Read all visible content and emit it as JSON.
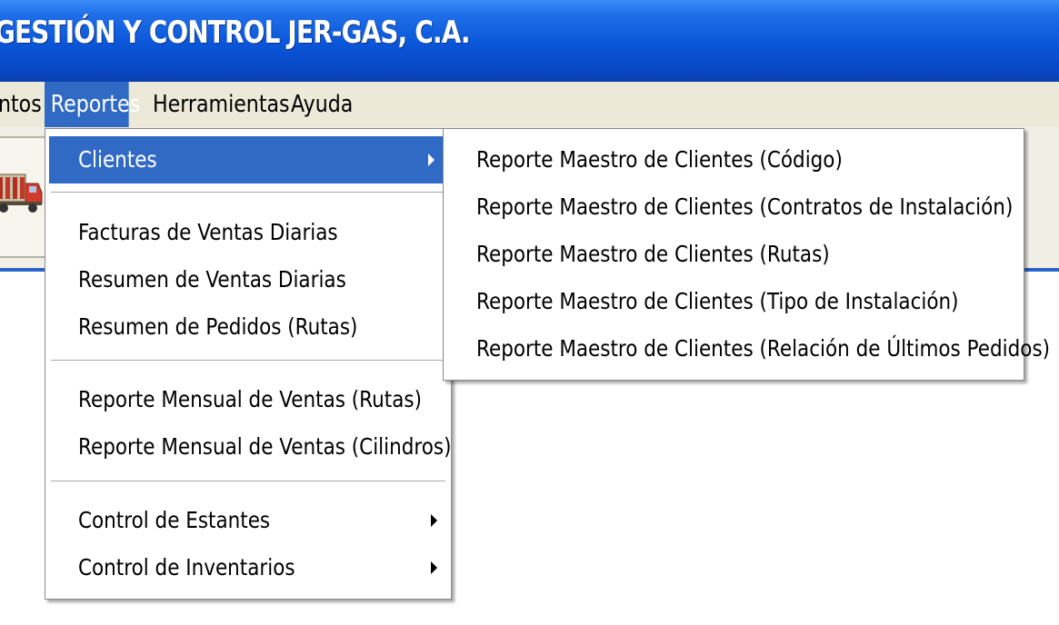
{
  "window": {
    "title": "GESTIÓN Y CONTROL JER-GAS, C.A."
  },
  "menubar": {
    "items": [
      {
        "label": "ntos"
      },
      {
        "label": "Reportes"
      },
      {
        "label": "Herramientas"
      },
      {
        "label": "Ayuda"
      }
    ]
  },
  "reportes_menu": {
    "clientes": "Clientes",
    "facturas_ventas_diarias": "Facturas de Ventas Diarias",
    "resumen_ventas_diarias": "Resumen de Ventas Diarias",
    "resumen_pedidos_rutas": "Resumen de Pedidos (Rutas)",
    "reporte_mensual_rutas": "Reporte Mensual de Ventas (Rutas)",
    "reporte_mensual_cilindros": "Reporte Mensual de Ventas (Cilindros)",
    "control_estantes": "Control de Estantes",
    "control_inventarios": "Control de Inventarios"
  },
  "clientes_submenu": {
    "items": [
      {
        "label": "Reporte Maestro de Clientes (Código)"
      },
      {
        "label": "Reporte Maestro de Clientes (Contratos de Instalación)"
      },
      {
        "label": "Reporte Maestro de Clientes (Rutas)"
      },
      {
        "label": "Reporte Maestro de Clientes (Tipo de Instalación)"
      },
      {
        "label": "Reporte Maestro de Clientes (Relación de Últimos Pedidos)"
      }
    ]
  },
  "toolbar": {
    "truck_button_icon": "gas-truck-icon"
  },
  "colors": {
    "titlebar": "#0a55d8",
    "highlight": "#316ac5",
    "menubar": "#ece9d8"
  }
}
